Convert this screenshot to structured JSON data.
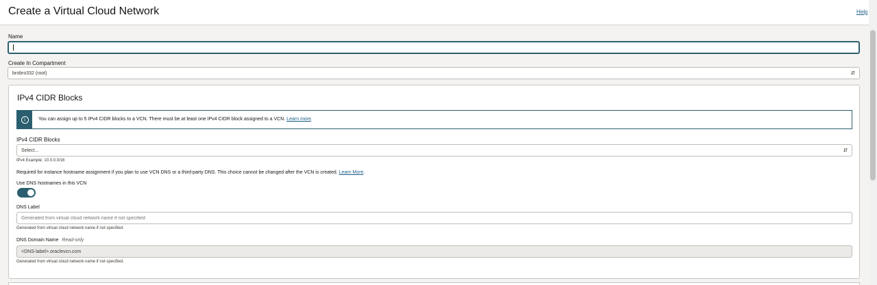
{
  "header": {
    "title": "Create a Virtual Cloud Network",
    "help_label": "Help"
  },
  "form": {
    "name": {
      "label": "Name",
      "value": ""
    },
    "compartment": {
      "label": "Create In Compartment",
      "value": "brobro332 (root)"
    }
  },
  "ipv4": {
    "title": "IPv4 CIDR Blocks",
    "info_text": "You can assign up to 5 IPv4 CIDR blocks to a VCN. There must be at least one IPv4 CIDR block assigned to a VCN.",
    "info_link": "Learn more",
    "info_suffix": ".",
    "cidr_label": "IPv4 CIDR Blocks",
    "cidr_placeholder": "Select...",
    "cidr_hint": "IPv4 Example: 10.0.0.0/16",
    "dns_note": "Required for instance hostname assignment if you plan to use VCN DNS or a third-party DNS. This choice cannot be changed after the VCN is created.",
    "dns_note_link": "Learn More",
    "dns_note_suffix": ".",
    "use_dns_label": "Use DNS hostnames in this VCN",
    "use_dns_enabled": true,
    "dns_label": {
      "label": "DNS Label",
      "placeholder": "Generated from virtual cloud network name if not specified",
      "hint": "Generated from virtual cloud network name if not specified."
    },
    "dns_domain": {
      "label": "DNS Domain Name",
      "readonly_tag": "Read-only",
      "value": "<DNS-label>.oraclevcn.com",
      "hint": "Generated from virtual cloud network name if not specified."
    }
  },
  "colors": {
    "accent": "#2a5e6e",
    "link": "#1a5e88",
    "background": "#f4f3f1"
  },
  "icons": {
    "info": "info-circle-icon",
    "select_chevron": "chevron-updown-icon"
  }
}
